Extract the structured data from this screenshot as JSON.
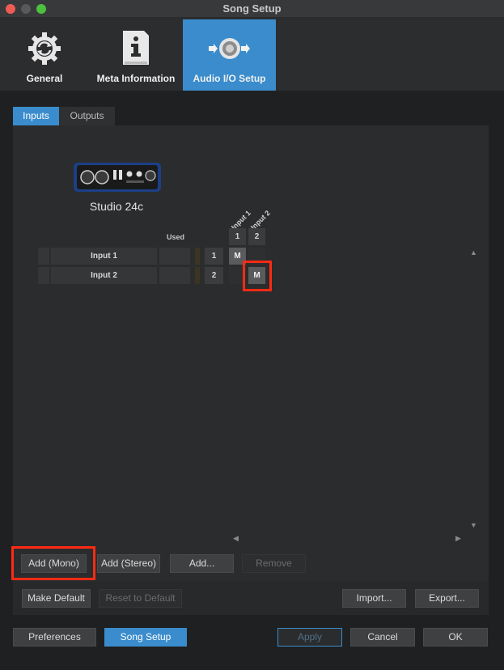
{
  "window": {
    "title": "Song Setup"
  },
  "top_tabs": [
    {
      "label": "General",
      "icon": "gear-refresh-icon",
      "active": false
    },
    {
      "label": "Meta Information",
      "icon": "info-document-icon",
      "active": false
    },
    {
      "label": "Audio I/O Setup",
      "icon": "audio-io-speaker-icon",
      "active": true
    }
  ],
  "sub_tabs": {
    "inputs": "Inputs",
    "outputs": "Outputs"
  },
  "device": {
    "name": "Studio 24c"
  },
  "matrix": {
    "used_label": "Used",
    "columns": [
      {
        "label": "Input 1",
        "num": "1"
      },
      {
        "label": "Input 2",
        "num": "2"
      }
    ],
    "rows": [
      {
        "name": "Input 1",
        "num": "1",
        "mapped": "M"
      },
      {
        "name": "Input 2",
        "num": "2",
        "mapped": "M"
      }
    ]
  },
  "panel_buttons": {
    "add_mono": "Add (Mono)",
    "add_stereo": "Add (Stereo)",
    "add": "Add...",
    "remove": "Remove"
  },
  "default_buttons": {
    "make_default": "Make Default",
    "reset_default": "Reset to Default",
    "import": "Import...",
    "export": "Export..."
  },
  "footer_buttons": {
    "preferences": "Preferences",
    "song_setup": "Song Setup",
    "apply": "Apply",
    "cancel": "Cancel",
    "ok": "OK"
  },
  "colors": {
    "accent": "#3a8ccc",
    "highlight": "#ff2a14"
  }
}
